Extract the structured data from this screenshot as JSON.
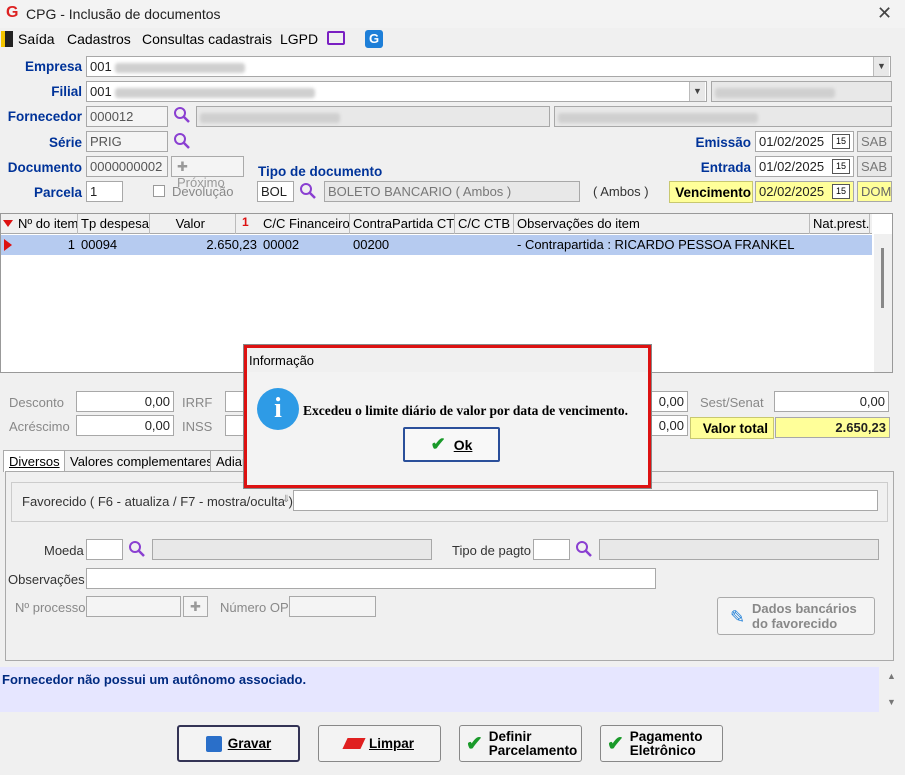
{
  "window": {
    "title": "CPG - Inclusão de documentos"
  },
  "menu": [
    "Saída",
    "Cadastros",
    "Consultas cadastrais",
    "LGPD"
  ],
  "labels": {
    "empresa": "Empresa",
    "filial": "Filial",
    "fornecedor": "Fornecedor",
    "serie": "Série",
    "documento": "Documento",
    "parcela": "Parcela",
    "proximo": "Próximo",
    "devolucao": "Devolução",
    "tipo_documento": "Tipo de documento",
    "emissao": "Emissão",
    "entrada": "Entrada",
    "vencimento": "Vencimento"
  },
  "fields": {
    "empresa": "001",
    "filial": "001",
    "fornecedor": "000012",
    "serie": "PRIG",
    "documento": "0000000002",
    "parcela": "1",
    "tipo_doc_code": "BOL",
    "tipo_doc_desc": "BOLETO BANCARIO ( Ambos )",
    "tipo_doc_suffix": "( Ambos )",
    "emissao": "01/02/2025",
    "emissao_day": "SAB",
    "entrada": "01/02/2025",
    "entrada_day": "SAB",
    "vencimento": "02/02/2025",
    "vencimento_day": "DOM"
  },
  "grid": {
    "columns": [
      "Nº do item",
      "Tp despesa",
      "Valor",
      "C/C Financeiro",
      "ContraPartida CTB",
      "C/C CTB",
      "Observações do item",
      "Nat.prest."
    ],
    "sort_marker": "1",
    "rows": [
      {
        "item": "1",
        "tp_despesa": "00094",
        "valor": "2.650,23",
        "cc_fin": "00002",
        "contrapartida": "00200",
        "cc_ctb": "",
        "obs": "- Contrapartida : RICARDO PESSOA FRANKEL",
        "nat": ""
      }
    ]
  },
  "totals": {
    "desconto_label": "Desconto",
    "desconto": "0,00",
    "acrescimo_label": "Acréscimo",
    "acrescimo": "0,00",
    "irrf_label": "IRRF",
    "inss_label": "INSS",
    "mid1": "0,00",
    "mid2": "0,00",
    "sest_label": "Sest/Senat",
    "sest": "0,00",
    "valor_total_label": "Valor total",
    "valor_total": "2.650,23"
  },
  "tabs": [
    "Diversos",
    "Valores complementares",
    "Adiar"
  ],
  "panel": {
    "favorecido_label": "Favorecido ( F6 - atualiza / F7 - mostra/oculta )",
    "moeda_label": "Moeda",
    "tipo_pagto_label": "Tipo de pagto",
    "observacoes_label": "Observações",
    "num_processo_label": "Nº processo",
    "numero_op_label": "Número OP",
    "dados_bancarios_label": "Dados bancários do favorecido"
  },
  "status_message": "Fornecedor não possui um autônomo associado.",
  "buttons": {
    "gravar": "Gravar",
    "limpar": "Limpar",
    "definir": "Definir Parcelamento",
    "pagamento": "Pagamento Eletrônico"
  },
  "dialog": {
    "title": "Informação",
    "message": "Excedeu o limite diário de valor por data de vencimento.",
    "ok": "Ok"
  },
  "colors": {
    "accent_label": "#003399",
    "highlight_yellow": "#ffff99",
    "selected_row": "#b6cbf0",
    "dialog_border": "#dd1111",
    "info_icon": "#2e9be6"
  }
}
